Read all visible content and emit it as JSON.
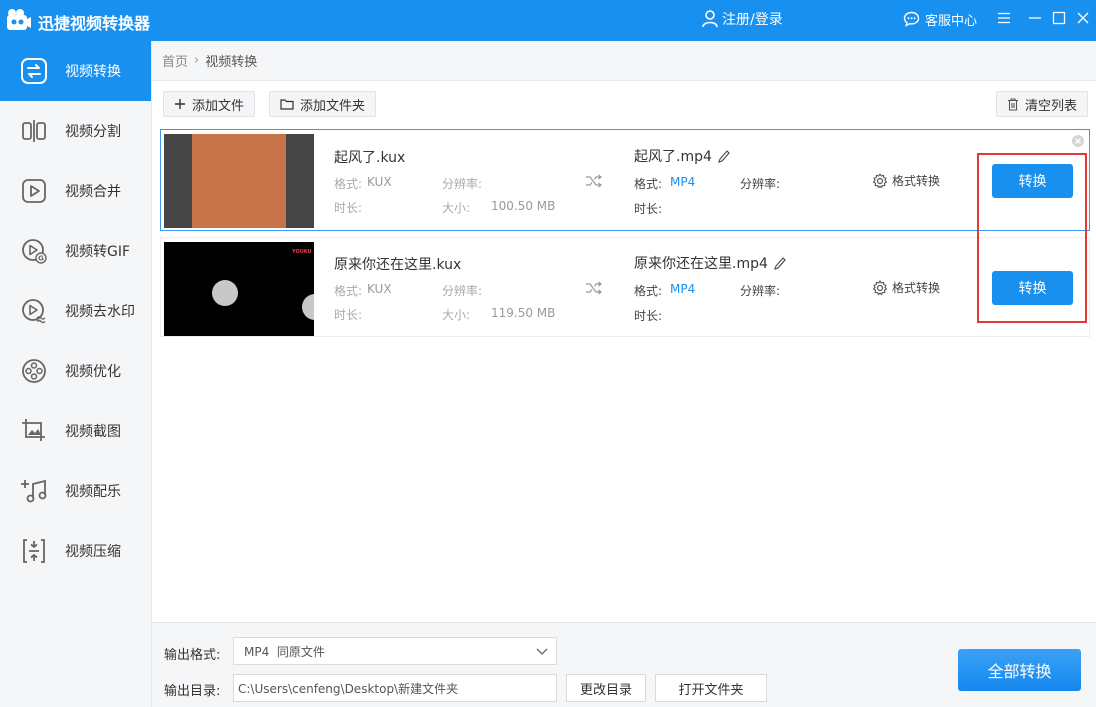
{
  "app": {
    "title": "迅捷视频转换器",
    "login": "注册/登录",
    "service": "客服中心",
    "accent": "#1890f0"
  },
  "sidebar": {
    "items": [
      {
        "label": "视频转换",
        "icon": "video-convert-icon",
        "active": true
      },
      {
        "label": "视频分割",
        "icon": "video-split-icon"
      },
      {
        "label": "视频合并",
        "icon": "video-merge-icon"
      },
      {
        "label": "视频转GIF",
        "icon": "video-gif-icon"
      },
      {
        "label": "视频去水印",
        "icon": "watermark-icon"
      },
      {
        "label": "视频优化",
        "icon": "film-reel-icon"
      },
      {
        "label": "视频截图",
        "icon": "screenshot-icon"
      },
      {
        "label": "视频配乐",
        "icon": "music-icon"
      },
      {
        "label": "视频压缩",
        "icon": "compress-icon"
      }
    ]
  },
  "breadcrumb": {
    "home": "首页",
    "sep": "›",
    "current": "视频转换"
  },
  "toolbar": {
    "add_file": "添加文件",
    "add_folder": "添加文件夹",
    "clear_list": "清空列表"
  },
  "files": [
    {
      "name": "起风了.kux",
      "format_label": "格式:",
      "format": "KUX",
      "resolution_label": "分辨率:",
      "duration_label": "时长:",
      "size_label": "大小:",
      "size": "100.50 MB",
      "out_name": "起风了.mp4",
      "out_format_label": "格式:",
      "out_format": "MP4",
      "out_resolution_label": "分辨率:",
      "out_duration_label": "时长:",
      "format_convert": "格式转换",
      "convert": "转换"
    },
    {
      "name": "原来你还在这里.kux",
      "format_label": "格式:",
      "format": "KUX",
      "resolution_label": "分辨率:",
      "duration_label": "时长:",
      "size_label": "大小:",
      "size": "119.50 MB",
      "out_name": "原来你还在这里.mp4",
      "out_format_label": "格式:",
      "out_format": "MP4",
      "out_resolution_label": "分辨率:",
      "out_duration_label": "时长:",
      "format_convert": "格式转换",
      "convert": "转换",
      "thumb_logo": "YOUKU"
    }
  ],
  "bottom": {
    "output_format_label": "输出格式:",
    "output_format_value": "MP4  同原文件",
    "output_dir_label": "输出目录:",
    "output_dir_value": "C:\\Users\\cenfeng\\Desktop\\新建文件夹",
    "change_dir": "更改目录",
    "open_folder": "打开文件夹",
    "convert_all": "全部转换"
  }
}
